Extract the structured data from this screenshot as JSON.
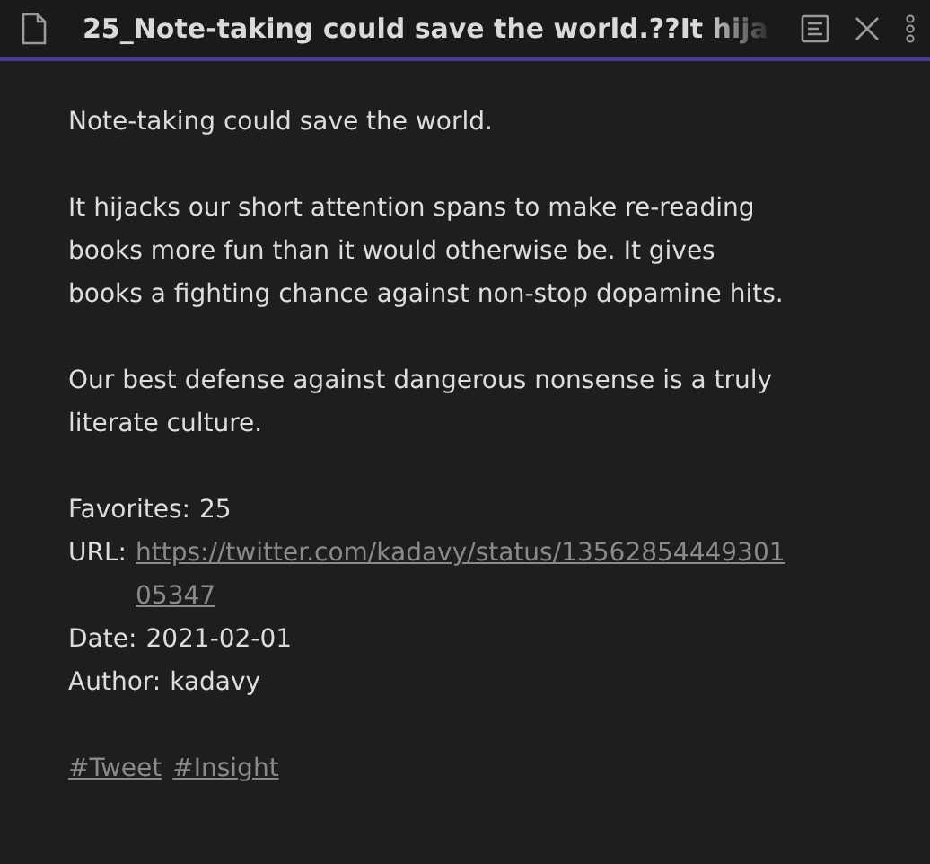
{
  "header": {
    "title": "25_Note-taking could save the world.??It hija"
  },
  "paragraphs": [
    "Note-taking could save the world.",
    "It hijacks our short attention spans to make re-reading books more fun than it would otherwise be. It gives books a fighting chance against non-stop dopamine hits.",
    "Our best defense against dangerous nonsense is a truly literate culture."
  ],
  "metadata": [
    {
      "kind": "text",
      "label": "Favorites:",
      "value": "25"
    },
    {
      "kind": "link",
      "label": "URL:",
      "value": "https://twitter.com/kadavy/status/1356285444930105347"
    },
    {
      "kind": "text",
      "label": "Date:",
      "value": "2021-02-01"
    },
    {
      "kind": "text",
      "label": "Author:",
      "value": "kadavy"
    }
  ],
  "tags": [
    "#Tweet",
    "#Insight"
  ]
}
